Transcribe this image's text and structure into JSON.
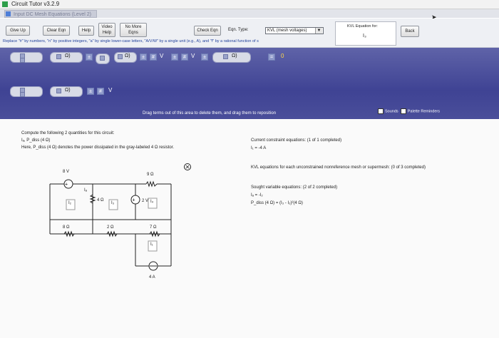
{
  "window": {
    "title": "Circuit Tutor v3.2.9",
    "tab_label": "Input DC Mesh Equations (Level 2)"
  },
  "toolbar": {
    "give_up": "Give Up",
    "clear_eqn": "Clear Eqn",
    "help": "Help",
    "video_help": "Video Help",
    "no_more_eqns": "No More Eqns",
    "check_eqn": "Check Eqn",
    "eqn_type_label": "Eqn. Type:",
    "eqn_type_value": "KVL (mesh voltages)",
    "back": "Back",
    "replace_hint": "Replace \"#\" by numbers, \"n\" by positive integers, \"a\" by single lower-case letters, \"A/V/W\" by a single unit (e.g., A), and \"f\" by a rational function of s"
  },
  "kvl_box": {
    "label": "KVL Equation for:",
    "value": "I₃"
  },
  "palette": {
    "unit_ohm": "Ω)",
    "unit_v": "V",
    "equals": "=",
    "zero": "0",
    "plus_minus": "+ / -",
    "drag_hint": "Drag terms out of this area to delete them, and drag them to reposition",
    "sounds_label": "Sounds",
    "reminders_label": "Palette Reminders"
  },
  "problem": {
    "instruction": "Compute the following 2 quantities for this circuit:",
    "quantities": "Iₐ, P_diss (4 Ω)",
    "note": "Here, P_diss (4 Ω) denotes the power dissipated in the gray-labeled 4 Ω resistor."
  },
  "circuit": {
    "v_source_top": "8 V",
    "r_top": "9 Ω",
    "r_4": "4 Ω",
    "v_source_mid": "2 V",
    "r_left": "8 Ω",
    "r_mid": "2 Ω",
    "r_right": "7 Ω",
    "i_source": "4 A",
    "i1": "I₁",
    "i2": "I₂",
    "i3": "I₃",
    "i4": "I₄",
    "ia": "Iₐ"
  },
  "equations": {
    "constraint_title": "Current constraint equations:",
    "constraint_progress": "(1 of 1 completed)",
    "constraint_eq": "I₁ = -4 A",
    "kvl_title": "KVL equations for each unconstrained nonreference mesh or supermesh:",
    "kvl_progress": "(0 of 3 completed)",
    "sought_title": "Sought variable equations:",
    "sought_progress": "(2 of 2 completed)",
    "sought_eq1": "Iₐ = -I₂",
    "sought_eq2_left": "P_diss (4 Ω) = (I₃ - I₂)²(4 Ω)"
  },
  "colors": {
    "palette_bg": "#3f4394",
    "hint_blue": "#1f3f9a",
    "icon_green": "#2e9e4a"
  }
}
